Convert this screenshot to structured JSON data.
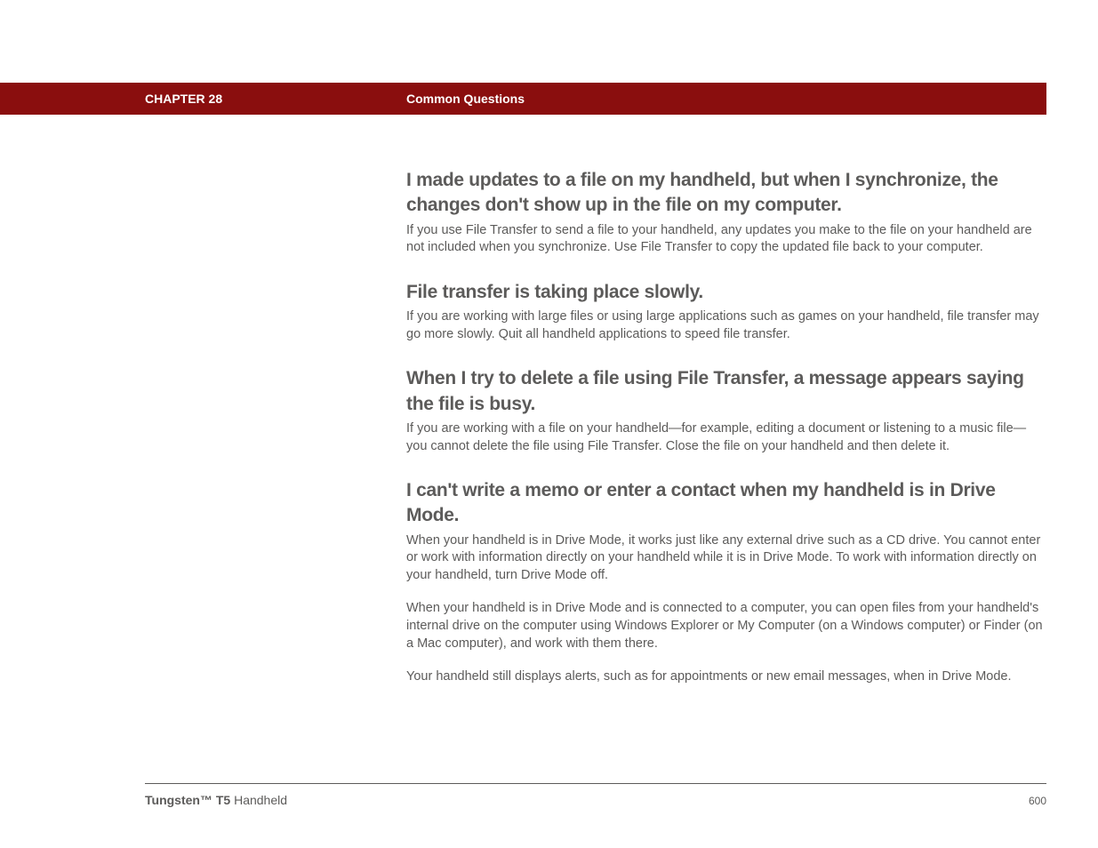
{
  "header": {
    "chapter": "CHAPTER 28",
    "section": "Common Questions"
  },
  "content": {
    "items": [
      {
        "heading": "I made updates to a file on my handheld, but when I synchronize, the changes don't show up in the file on my computer.",
        "paragraphs": [
          "If you use File Transfer to send a file to your handheld, any updates you make to the file on your handheld are not included when you synchronize. Use File Transfer to copy the updated file back to your computer."
        ]
      },
      {
        "heading": "File transfer is taking place slowly.",
        "paragraphs": [
          "If you are working with large files or using large applications such as games on your handheld, file transfer may go more slowly. Quit all handheld applications to speed file transfer."
        ]
      },
      {
        "heading": "When I try to delete a file using File Transfer, a message appears saying the file is busy.",
        "paragraphs": [
          "If you are working with a file on your handheld—for example, editing a document or listening to a music file—you cannot delete the file using File Transfer. Close the file on your handheld and then delete it."
        ]
      },
      {
        "heading": "I can't write a memo or enter a contact when my handheld is in Drive Mode.",
        "paragraphs": [
          "When your handheld is in Drive Mode, it works just like any external drive such as a CD drive. You cannot enter or work with information directly on your handheld while it is in Drive Mode. To work with information directly on your handheld, turn Drive Mode off.",
          "When your handheld is in Drive Mode and is connected to a computer, you can open files from your handheld's internal drive on the computer using Windows Explorer or My Computer (on a Windows computer) or Finder (on a Mac computer), and work with them there.",
          "Your handheld still displays alerts, such as for appointments or new email messages, when in Drive Mode."
        ]
      }
    ]
  },
  "footer": {
    "product_bold": "Tungsten™ T5",
    "product_rest": " Handheld",
    "page": "600"
  }
}
